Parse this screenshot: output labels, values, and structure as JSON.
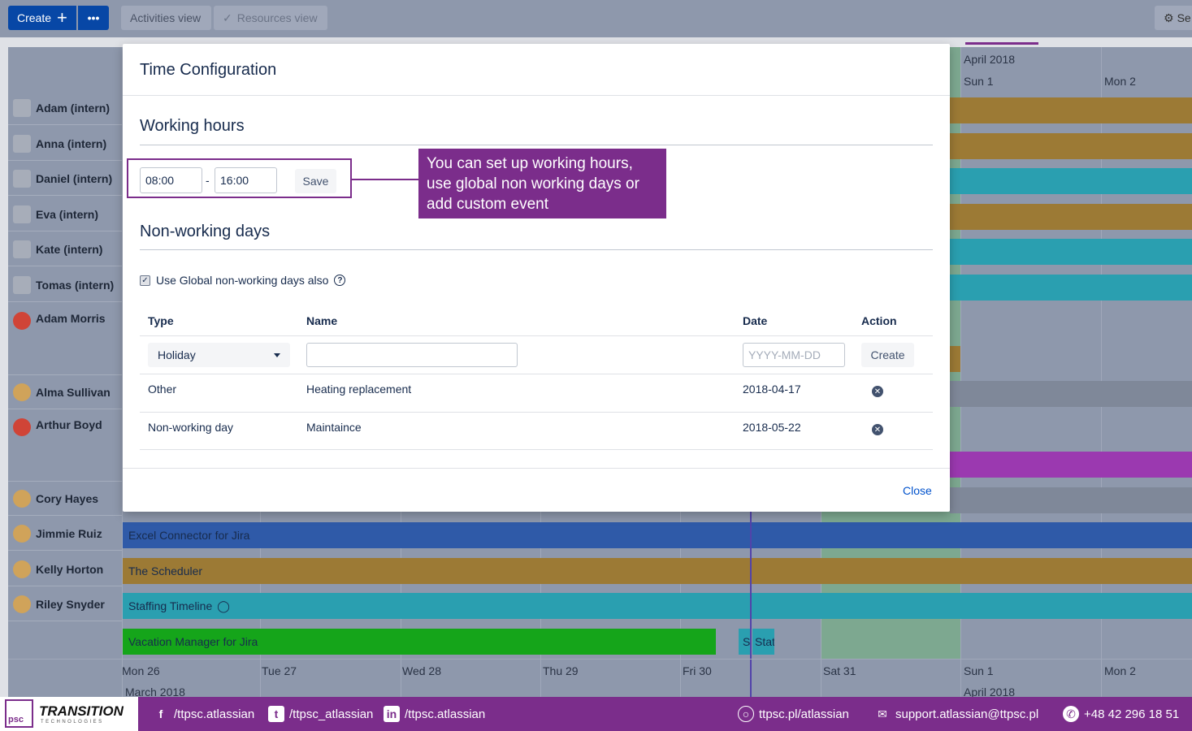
{
  "toolbar": {
    "create_label": "Create",
    "more_label": "•••",
    "tabs": [
      {
        "label": "Activities view"
      },
      {
        "label": "Resources view"
      }
    ],
    "settings_label": "Se"
  },
  "resources": [
    {
      "name": "Adam (intern)"
    },
    {
      "name": "Anna (intern)"
    },
    {
      "name": "Daniel (intern)"
    },
    {
      "name": "Eva (intern)"
    },
    {
      "name": "Kate (intern)"
    },
    {
      "name": "Tomas (intern)"
    },
    {
      "name": "Adam Morris"
    },
    {
      "name": "Alma Sullivan"
    },
    {
      "name": "Arthur Boyd"
    },
    {
      "name": "Cory Hayes"
    },
    {
      "name": "Jimmie Ruiz"
    },
    {
      "name": "Kelly Horton"
    },
    {
      "name": "Riley Snyder"
    }
  ],
  "timeline": {
    "top_month": "April 2018",
    "top_days": [
      "Sun 1",
      "Mon 2"
    ],
    "bottom_days": [
      "Mon 26",
      "Tue 27",
      "Wed 28",
      "Thu 29",
      "Fri 30",
      "Sat 31",
      "Sun 1",
      "Mon 2"
    ],
    "bottom_months": [
      "March 2018",
      "April 2018"
    ]
  },
  "bars": {
    "excel": "Excel Connector for Jira",
    "scheduler": "The Scheduler",
    "staffing": "Staffing Timeline",
    "vacation": "Vacation Manager for Jira",
    "small1": "S",
    "small2": "Stat"
  },
  "colors": {
    "purple": "#7b2d8b",
    "ochre": "#9c7a35",
    "teal": "#2a9fb0",
    "blue": "#2f5aa8",
    "green": "#15a51a",
    "weekend": "#7da890",
    "link": "#0052cc"
  },
  "modal": {
    "title": "Time Configuration",
    "working_hours_title": "Working hours",
    "start_time": "08:00",
    "dash": "-",
    "end_time": "16:00",
    "save_label": "Save",
    "callout": "You can set up working hours, use global non working days or add custom event",
    "non_working_title": "Non-working days",
    "use_global_label": "Use Global non-working days also",
    "help_icon": "question-circle-icon",
    "table_headers": {
      "type": "Type",
      "name": "Name",
      "date": "Date",
      "action": "Action"
    },
    "new_row": {
      "type_selected": "Holiday",
      "name_value": "",
      "date_placeholder": "YYYY-MM-DD",
      "create_label": "Create"
    },
    "rows": [
      {
        "type": "Other",
        "name": "Heating replacement",
        "date": "2018-04-17"
      },
      {
        "type": "Non-working day",
        "name": "Maintaince",
        "date": "2018-05-22"
      }
    ],
    "close_label": "Close"
  },
  "footer": {
    "logo_psc": "psc",
    "logo_name": "TRANSITION",
    "logo_sub": "TECHNOLOGIES",
    "facebook": "/ttpsc.atlassian",
    "twitter": "/ttpsc_atlassian",
    "linkedin": "/ttpsc.atlassian",
    "website": "ttpsc.pl/atlassian",
    "email": "support.atlassian@ttpsc.pl",
    "phone": "+48 42 296 18 51"
  }
}
